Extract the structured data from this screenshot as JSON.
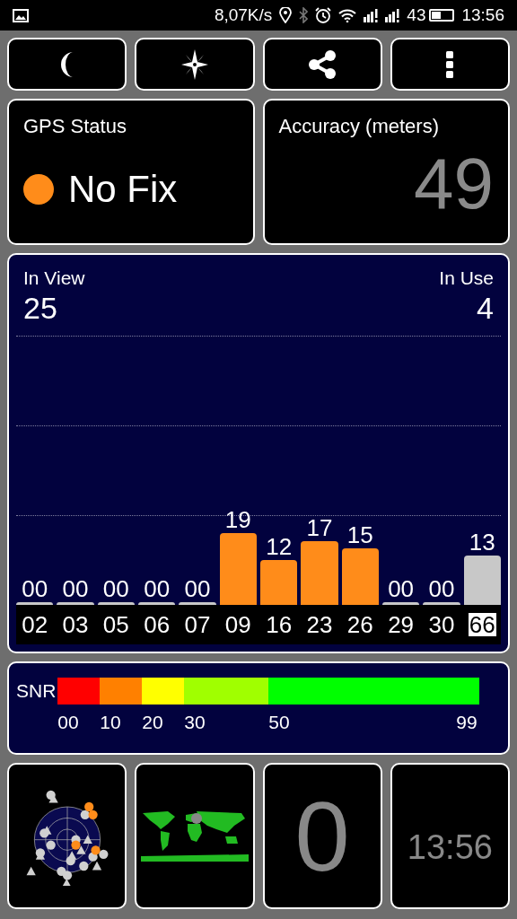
{
  "status_bar": {
    "speed": "8,07K/s",
    "battery_text": "43",
    "time": "13:56"
  },
  "toolbar": [
    {
      "kind": "night"
    },
    {
      "kind": "compass"
    },
    {
      "kind": "share"
    },
    {
      "kind": "menu"
    }
  ],
  "gps_status": {
    "title": "GPS Status",
    "value": "No Fix",
    "color": "#ff8c1a"
  },
  "accuracy": {
    "title": "Accuracy (meters)",
    "value": "49"
  },
  "sky": {
    "in_view_label": "In View",
    "in_view": "25",
    "in_use_label": "In Use",
    "in_use": "4",
    "chart_data": {
      "type": "bar",
      "categories": [
        "02",
        "03",
        "05",
        "06",
        "07",
        "09",
        "16",
        "23",
        "26",
        "29",
        "30",
        "66"
      ],
      "values": [
        0,
        0,
        0,
        0,
        0,
        19,
        12,
        17,
        15,
        0,
        0,
        13
      ],
      "value_labels": [
        "00",
        "00",
        "00",
        "00",
        "00",
        "19",
        "12",
        "17",
        "15",
        "00",
        "00",
        "13"
      ]
    },
    "satellites": [
      {
        "in_use": false,
        "highlighted": false
      },
      {
        "in_use": false,
        "highlighted": false
      },
      {
        "in_use": false,
        "highlighted": false
      },
      {
        "in_use": false,
        "highlighted": false
      },
      {
        "in_use": false,
        "highlighted": false
      },
      {
        "in_use": true,
        "highlighted": false
      },
      {
        "in_use": true,
        "highlighted": false
      },
      {
        "in_use": true,
        "highlighted": false
      },
      {
        "in_use": true,
        "highlighted": false
      },
      {
        "in_use": false,
        "highlighted": false
      },
      {
        "in_use": false,
        "highlighted": false
      },
      {
        "in_use": false,
        "highlighted": true
      }
    ]
  },
  "snr": {
    "label": "SNR",
    "segments": [
      {
        "label": "00",
        "color": "#ff0000"
      },
      {
        "label": "10",
        "color": "#ff8000"
      },
      {
        "label": "20",
        "color": "#ffff00"
      },
      {
        "label": "30",
        "color": "#a0ff00"
      },
      {
        "label": "50",
        "color": "#00ff00"
      }
    ],
    "max_label": "99"
  },
  "tiles": [
    {
      "kind": "skyplot"
    },
    {
      "kind": "map"
    },
    {
      "kind": "number",
      "value": "0"
    },
    {
      "kind": "clock",
      "value": "13:56"
    }
  ]
}
